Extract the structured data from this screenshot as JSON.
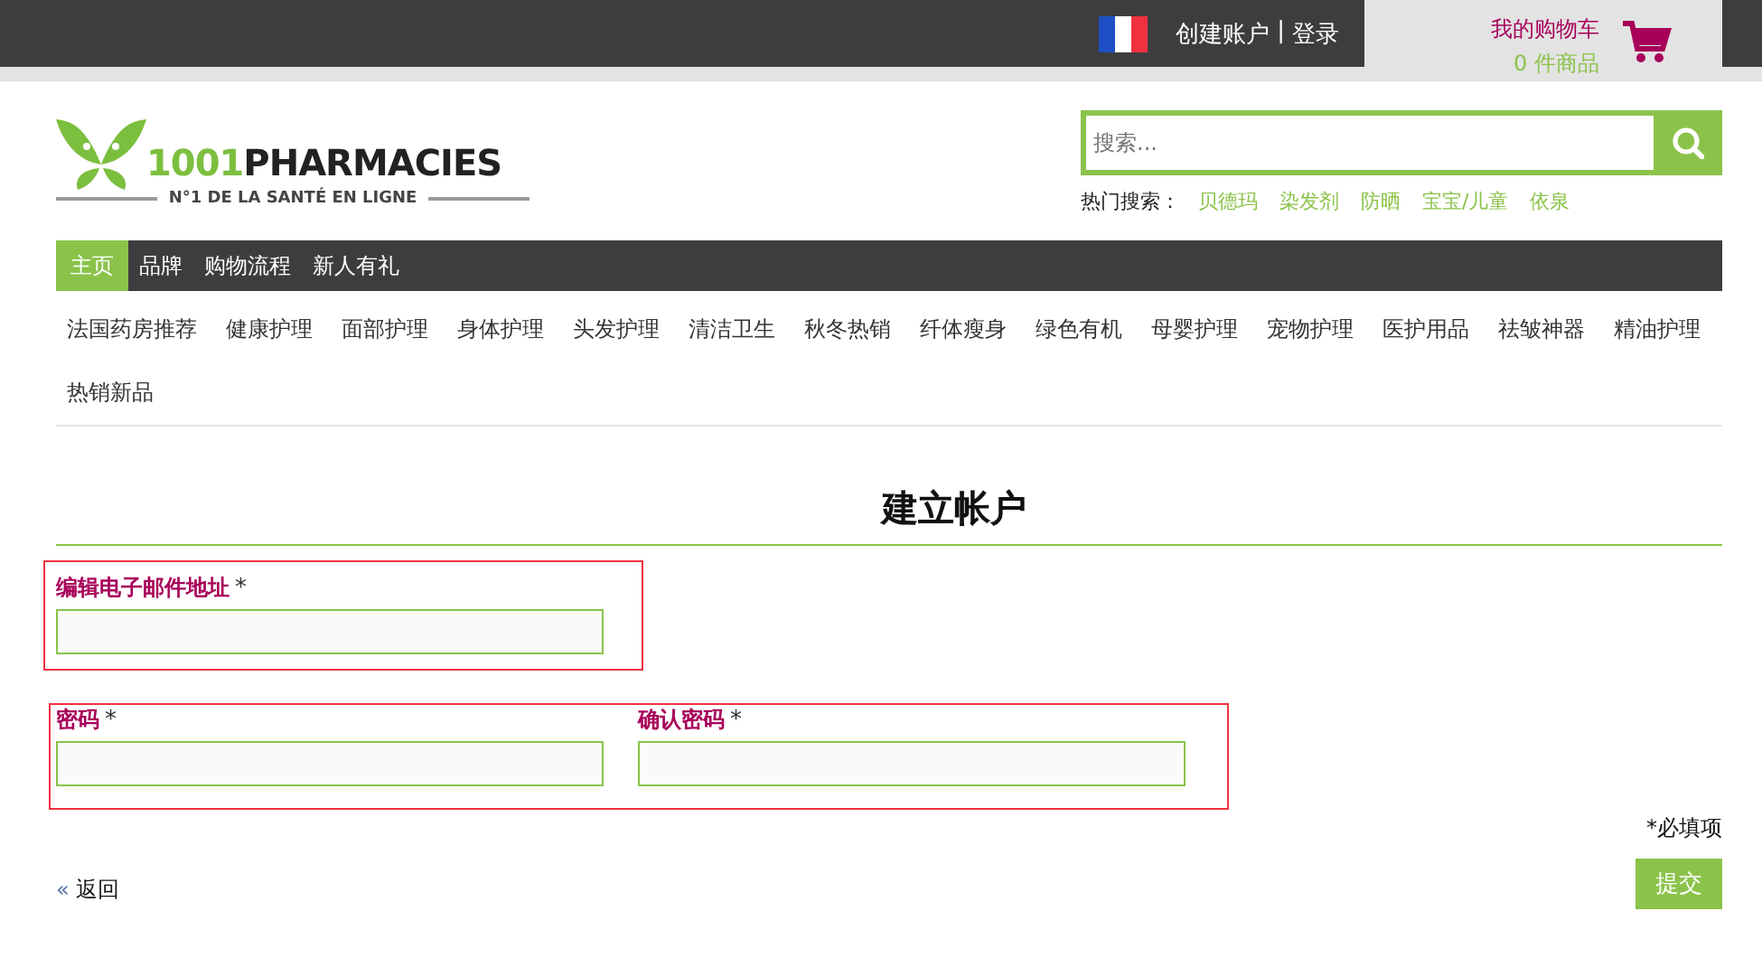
{
  "top_bar": {
    "links": [
      "创建账户",
      "登录"
    ],
    "separator": "|",
    "cart": {
      "title": "我的购物车",
      "count": "0 件商品"
    }
  },
  "logo": {
    "name_part1": "1001",
    "name_part2": "PHARMACIES",
    "tagline": "N°1 DE LA SANTÉ EN LIGNE"
  },
  "search": {
    "placeholder": "搜索...",
    "hot_label": "热门搜索：",
    "hot_terms": [
      "贝德玛",
      "染发剂",
      "防晒",
      "宝宝/儿童",
      "依泉"
    ]
  },
  "main_nav": [
    {
      "label": "主页",
      "selected": true
    },
    {
      "label": "品牌",
      "selected": false
    },
    {
      "label": "购物流程",
      "selected": false
    },
    {
      "label": "新人有礼",
      "selected": false
    }
  ],
  "categories": [
    "法国药房推荐",
    "健康护理",
    "面部护理",
    "身体护理",
    "头发护理",
    "清洁卫生",
    "秋冬热销",
    "纤体瘦身",
    "绿色有机",
    "母婴护理",
    "宠物护理",
    "医护用品",
    "祛皱神器",
    "精油护理",
    "热销新品"
  ],
  "page_title": "建立帐户",
  "form_groups": [
    {
      "highlighted": true,
      "fields": [
        {
          "label": "编辑电子邮件地址",
          "required": "*"
        }
      ]
    },
    {
      "highlighted": true,
      "fields": [
        {
          "label": "密码",
          "required": "*"
        },
        {
          "label": "确认密码",
          "required": "*"
        }
      ]
    }
  ],
  "required_note": "*必填项",
  "back_link": {
    "arrow": "«",
    "label": "返回"
  },
  "submit_button": "提交"
}
